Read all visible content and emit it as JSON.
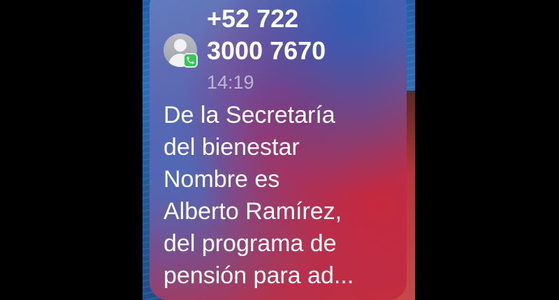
{
  "notification": {
    "sender_line_1": "+52 722",
    "sender_line_2": "3000 7670",
    "time": "14:19",
    "message_lines": [
      "De la Secretaría",
      "del bienestar",
      "Nombre es",
      "Alberto Ramírez,",
      "del programa de",
      "pensión para ad..."
    ],
    "avatar_icon": "contact-avatar-icon",
    "badge_icon": "phone-icon",
    "badge_color": "#35c759"
  }
}
